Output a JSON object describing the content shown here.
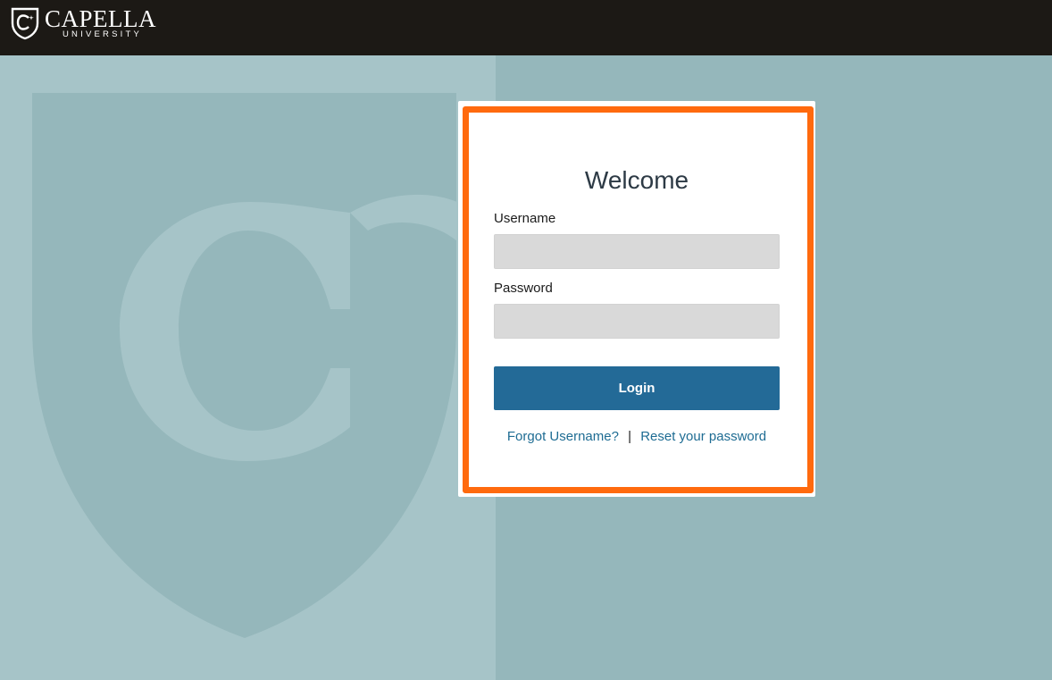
{
  "header": {
    "brand_name": "CAPELLA",
    "brand_sub": "UNIVERSITY",
    "logo_icon": "capella-shield-icon",
    "background_color": "#1c1915"
  },
  "login": {
    "title": "Welcome",
    "username_label": "Username",
    "username_value": "",
    "password_label": "Password",
    "password_value": "",
    "login_button": "Login",
    "forgot_username_link": "Forgot Username?",
    "separator": "|",
    "reset_password_link": "Reset your password"
  },
  "colors": {
    "background": "#95b7bb",
    "watermark": "#a6c4c8",
    "button": "#236a97",
    "link": "#1e6c93",
    "highlight_border": "#ff6a0e"
  },
  "background": {
    "watermark_icon": "capella-shield-watermark-icon"
  }
}
